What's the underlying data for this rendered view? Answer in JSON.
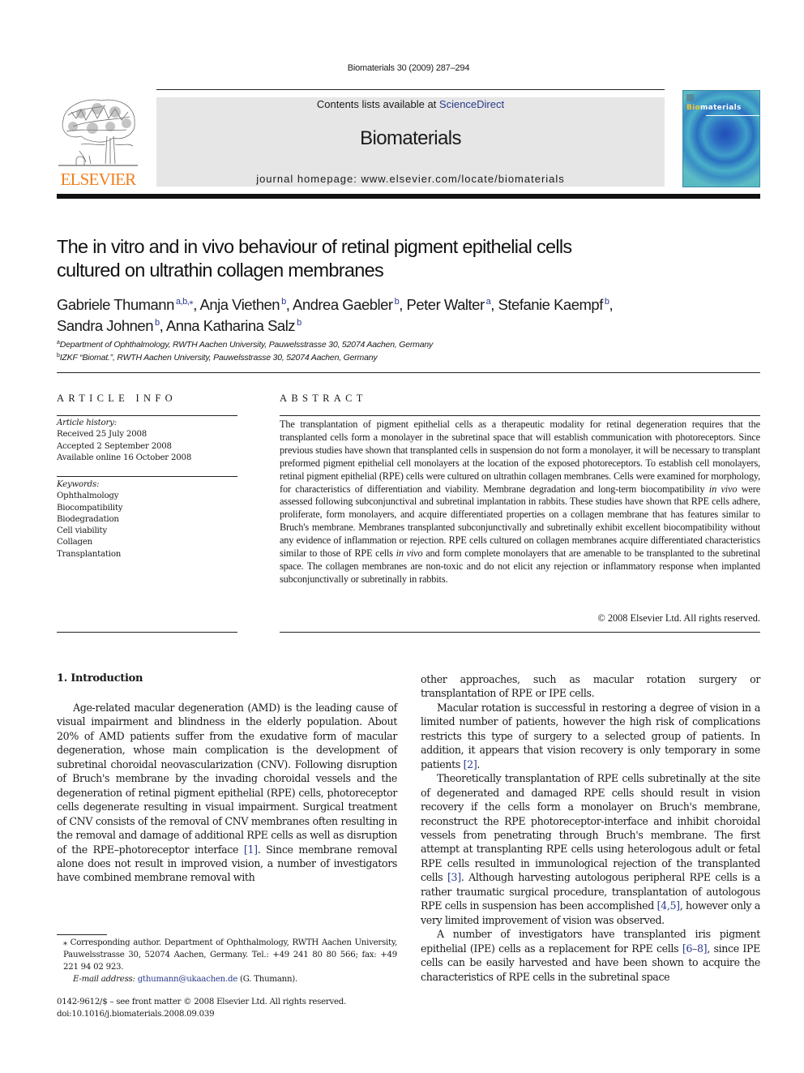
{
  "running_head": "Biomaterials 30 (2009) 287–294",
  "masthead": {
    "publisher_logo_text": "ELSEVIER",
    "contents_prefix": "Contents lists available at ",
    "contents_link": "ScienceDirect",
    "journal_name": "Biomaterials",
    "homepage_text": "journal homepage: www.elsevier.com/locate/biomaterials",
    "cover": {
      "title_first": "Bio",
      "title_rest": "materials",
      "colors": {
        "base": "#3f9fc8",
        "dark": "#1f4fb8",
        "accent": "#f4c430"
      }
    },
    "logo_color": "#f07f1c"
  },
  "article": {
    "title_line1": "The in vitro and in vivo behaviour of retinal pigment epithelial cells",
    "title_line2": "cultured on ultrathin collagen membranes",
    "authors": [
      {
        "name": "Gabriele Thumann",
        "sup": "a,b,⁎",
        "sep": ", "
      },
      {
        "name": "Anja Viethen",
        "sup": "b",
        "sep": ", "
      },
      {
        "name": "Andrea Gaebler",
        "sup": "b",
        "sep": ", "
      },
      {
        "name": "Peter Walter",
        "sup": "a",
        "sep": ", "
      },
      {
        "name": "Stefanie Kaempf",
        "sup": "b",
        "sep": ","
      },
      {
        "name": "Sandra Johnen",
        "sup": "b",
        "sep": ", "
      },
      {
        "name": "Anna Katharina Salz",
        "sup": "b",
        "sep": ""
      }
    ],
    "affiliations": [
      {
        "mark": "a",
        "text": "Department of Ophthalmology, RWTH Aachen University, Pauwelsstrasse 30, 52074 Aachen, Germany"
      },
      {
        "mark": "b",
        "text": "IZKF “Biomat.”, RWTH Aachen University, Pauwelsstrasse 30, 52074 Aachen, Germany"
      }
    ]
  },
  "article_info": {
    "heading": "ARTICLE INFO",
    "history_label": "Article history:",
    "history": [
      "Received 25 July 2008",
      "Accepted 2 September 2008",
      "Available online 16 October 2008"
    ],
    "keywords_label": "Keywords:",
    "keywords": [
      "Ophthalmology",
      "Biocompatibility",
      "Biodegradation",
      "Cell viability",
      "Collagen",
      "Transplantation"
    ]
  },
  "abstract": {
    "heading": "ABSTRACT",
    "part1": "The transplantation of pigment epithelial cells as a therapeutic modality for retinal degeneration requires that the transplanted cells form a monolayer in the subretinal space that will establish communication with photoreceptors. Since previous studies have shown that transplanted cells in suspension do not form a monolayer, it will be necessary to transplant preformed pigment epithelial cell monolayers at the location of the exposed photoreceptors. To establish cell monolayers, retinal pigment epithelial (RPE) cells were cultured on ultrathin collagen membranes. Cells were examined for morphology, for characteristics of differentiation and viability. Membrane degradation and long-term biocompatibility ",
    "italic1": "in vivo",
    "part2": " were assessed following subconjunctival and subretinal implantation in rabbits. These studies have shown that RPE cells adhere, proliferate, form monolayers, and acquire differentiated properties on a collagen membrane that has features similar to Bruch's membrane. Membranes transplanted subconjunctivally and subretinally exhibit excellent biocompatibility without any evidence of inflammation or rejection. RPE cells cultured on collagen membranes acquire differentiated characteristics similar to those of RPE cells ",
    "italic2": "in vivo",
    "part3": " and form complete monolayers that are amenable to be transplanted to the subretinal space. The collagen membranes are non-toxic and do not elicit any rejection or inflammatory response when implanted subconjunctivally or subretinally in rabbits.",
    "copyright": "© 2008 Elsevier Ltd. All rights reserved."
  },
  "introduction": {
    "heading": "1.  Introduction",
    "left_p1_a": "Age-related macular degeneration (AMD) is the leading cause of visual impairment and blindness in the elderly population. About 20% of AMD patients suffer from the exudative form of macular degeneration, whose main complication is the development of subretinal choroidal neovascularization (CNV). Following disruption of Bruch's membrane by the invading choroidal vessels and the degeneration of retinal pigment epithelial (RPE) cells, photoreceptor cells degenerate resulting in visual impairment. Surgical treatment of CNV consists of the removal of CNV membranes often resulting in the removal and damage of additional RPE cells as well as disruption of the RPE–photoreceptor interface ",
    "ref1": "[1]",
    "left_p1_b": ". Since membrane removal alone does not result in improved vision, a number of investigators have combined membrane removal with",
    "right_p0": "other approaches, such as macular rotation surgery or transplantation of RPE or IPE cells.",
    "right_p1_a": "Macular rotation is successful in restoring a degree of vision in a limited number of patients, however the high risk of complications restricts this type of surgery to a selected group of patients. In addition, it appears that vision recovery is only temporary in some patients ",
    "ref2": "[2]",
    "right_p1_b": ".",
    "right_p2_a": "Theoretically transplantation of RPE cells subretinally at the site of degenerated and damaged RPE cells should result in vision recovery if the cells form a monolayer on Bruch's membrane, reconstruct the RPE photoreceptor-interface and inhibit choroidal vessels from penetrating through Bruch's membrane. The first attempt at transplanting RPE cells using heterologous adult or fetal RPE cells resulted in immunological rejection of the transplanted cells ",
    "ref3": "[3]",
    "right_p2_b": ". Although harvesting autologous peripheral RPE cells is a rather traumatic surgical procedure, transplantation of autologous RPE cells in suspension has been accomplished ",
    "ref45": "[4,5]",
    "right_p2_c": ", however only a very limited improvement of vision was observed.",
    "right_p3_a": "A number of investigators have transplanted iris pigment epithelial (IPE) cells as a replacement for RPE cells ",
    "ref68": "[6–8]",
    "right_p3_b": ", since IPE cells can be easily harvested and have been shown to acquire the characteristics of RPE cells in the subretinal space"
  },
  "footnote": {
    "corresponding": "⁎ Corresponding author. Department of Ophthalmology, RWTH Aachen University, Pauwelsstrasse 30, 52074 Aachen, Germany. Tel.: +49 241 80 80 566; fax: +49 221 94 02 923.",
    "email_label": "E-mail address:",
    "email": "gthumann@ukaachen.de",
    "email_suffix": " (G. Thumann)."
  },
  "bottom_meta": {
    "issn_line": "0142-9612/$ – see front matter © 2008 Elsevier Ltd. All rights reserved.",
    "doi": "doi:10.1016/j.biomaterials.2008.09.039"
  }
}
